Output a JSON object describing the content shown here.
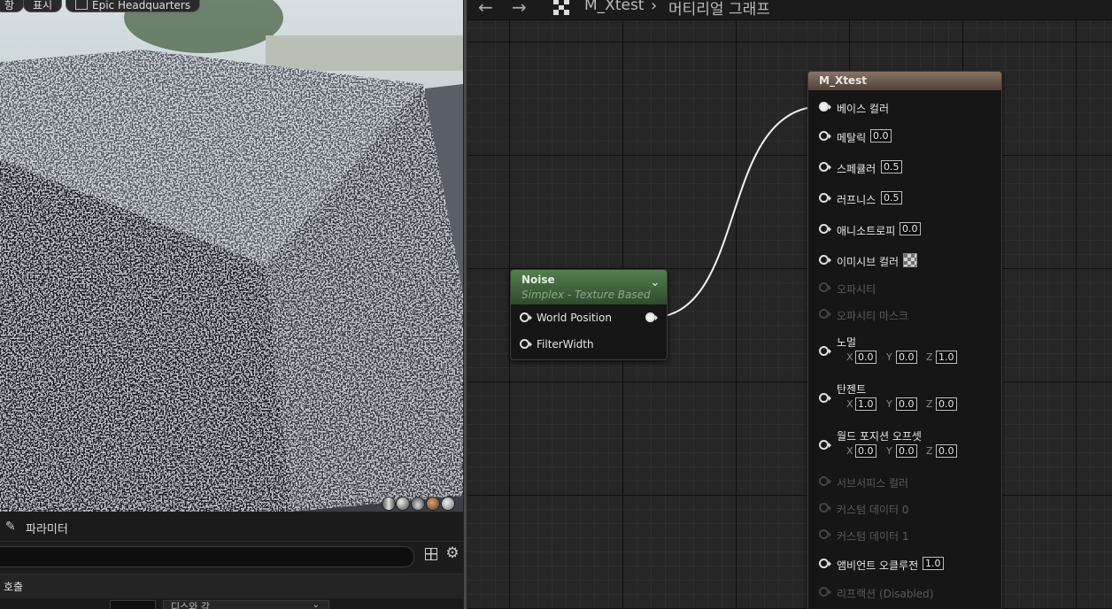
{
  "viewport": {
    "chips": [
      "항",
      "표시",
      "Epic Headquarters"
    ],
    "preview_balls": [
      "shader-ball",
      "sphere",
      "plane",
      "cube",
      "teapot"
    ]
  },
  "details": {
    "tab_icon": "pencil-icon",
    "tab_label": "파라미터",
    "section_label": "호출",
    "property_select": "디스와 각",
    "colors": {
      "panel": "#1c1c1c",
      "section": "#242424"
    }
  },
  "graph": {
    "breadcrumb": [
      "M_Xtest",
      "머티리얼 그래프"
    ],
    "breadcrumb_separator": "›",
    "nav_back": "←",
    "nav_forward": "→"
  },
  "noise_node": {
    "title": "Noise",
    "subtitle": "Simplex - Texture Based",
    "collapse_glyph": "⌄",
    "inputs": [
      "World Position",
      "FilterWidth"
    ],
    "header_color": "#3f6a3c"
  },
  "material_node": {
    "title": "M_Xtest",
    "header_color": "#6e5a4c",
    "pins": [
      {
        "label": "베이스 컬러",
        "connected": true
      },
      {
        "label": "메탈릭",
        "value": "0.0"
      },
      {
        "label": "스페큘러",
        "value": "0.5"
      },
      {
        "label": "러프니스",
        "value": "0.5"
      },
      {
        "label": "애니소트로피",
        "value": "0.0"
      },
      {
        "label": "이미시브 컬러",
        "swatch": "checker"
      },
      {
        "label": "오파시티",
        "disabled": true
      },
      {
        "label": "오파시티 마스크",
        "disabled": true
      },
      {
        "label": "노멀",
        "vector": {
          "X": "0.0",
          "Y": "0.0",
          "Z": "1.0"
        }
      },
      {
        "label": "탄젠트",
        "vector": {
          "X": "1.0",
          "Y": "0.0",
          "Z": "0.0"
        }
      },
      {
        "label": "월드 포지션 오프셋",
        "vector": {
          "X": "0.0",
          "Y": "0.0",
          "Z": "0.0"
        }
      },
      {
        "label": "서브서피스 컬러",
        "disabled": true
      },
      {
        "label": "커스텀 데이터 0",
        "disabled": true
      },
      {
        "label": "커스텀 데이터 1",
        "disabled": true
      },
      {
        "label": "앰비언트 오클루전",
        "value": "1.0"
      },
      {
        "label": "리프랙션 (Disabled)",
        "disabled": true
      }
    ]
  }
}
